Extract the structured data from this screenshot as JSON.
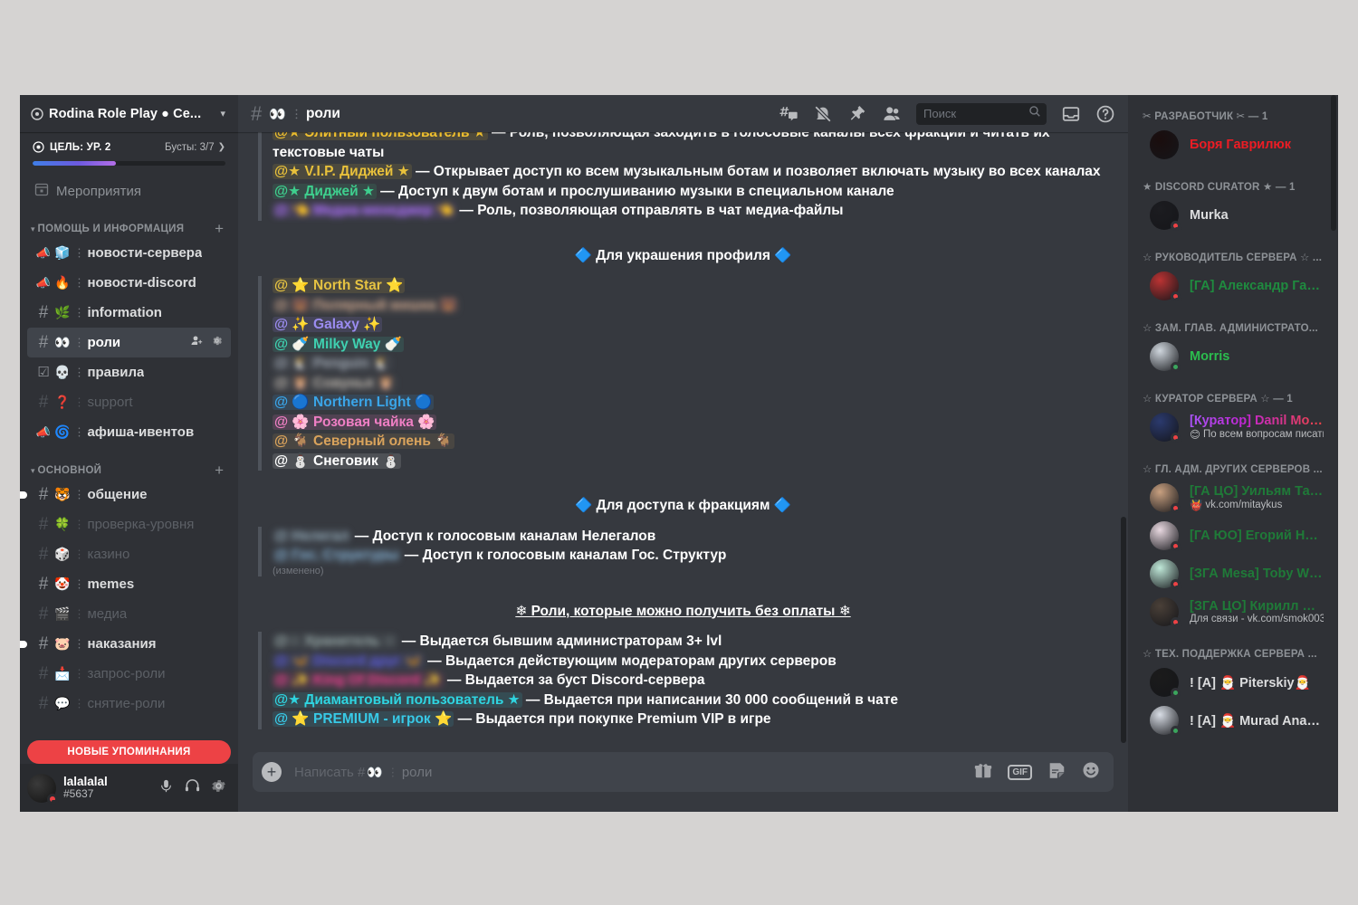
{
  "server": {
    "name": "Rodina Role Play ● Ce...",
    "icon": "server-badge-icon",
    "boost": {
      "goal_label": "ЦЕЛЬ: УР. 2",
      "boosts_label": "Бусты: 3/7",
      "progress_percent": 43
    }
  },
  "sidebar": {
    "events_label": "Мероприятия",
    "categories": [
      {
        "label": "ПОМОЩЬ И ИНФОРМАЦИЯ",
        "channels": [
          {
            "type": "announcement",
            "emoji": "🧊",
            "name": "новости-сервера",
            "state": "bright"
          },
          {
            "type": "announcement",
            "emoji": "🔥",
            "name": "новости-discord",
            "state": "bright"
          },
          {
            "type": "text",
            "emoji": "🌿",
            "name": "information",
            "state": "bright"
          },
          {
            "type": "text",
            "emoji": "👀",
            "name": "роли",
            "state": "active"
          },
          {
            "type": "rules",
            "emoji": "💀",
            "name": "правила",
            "state": "bright"
          },
          {
            "type": "text",
            "emoji": "❓",
            "name": "support",
            "state": "dim"
          },
          {
            "type": "announcement",
            "emoji": "🌀",
            "name": "афиша-ивентов",
            "state": "bright"
          }
        ]
      },
      {
        "label": "ОСНОВНОЙ",
        "channels": [
          {
            "type": "text",
            "emoji": "🐯",
            "name": "общение",
            "state": "bright",
            "unread": true
          },
          {
            "type": "text",
            "emoji": "🍀",
            "name": "проверка-уровня",
            "state": "dim"
          },
          {
            "type": "text",
            "emoji": "🎲",
            "name": "казино",
            "state": "dim"
          },
          {
            "type": "text",
            "emoji": "🤡",
            "name": "memes",
            "state": "bright"
          },
          {
            "type": "text",
            "emoji": "🎬",
            "name": "медиа",
            "state": "dim"
          },
          {
            "type": "text",
            "emoji": "🐷",
            "name": "наказания",
            "state": "bright",
            "unread": true
          },
          {
            "type": "text",
            "emoji": "📩",
            "name": "запрос-роли",
            "state": "dim"
          },
          {
            "type": "text",
            "emoji": "💬",
            "name": "снятие-роли",
            "state": "dim"
          }
        ]
      }
    ],
    "mentions_banner": "НОВЫЕ УПОМИНАНИЯ",
    "user": {
      "name": "lalalalal",
      "tag": "#5637",
      "status": "dnd",
      "icons": [
        "microphone-icon",
        "headphones-icon",
        "gear-icon"
      ]
    }
  },
  "topbar": {
    "channel_emoji": "👀",
    "channel_name": "роли",
    "icons": [
      "threads-icon",
      "notifications-muted-icon",
      "pinned-messages-icon",
      "member-list-icon",
      "inbox-icon",
      "help-icon"
    ],
    "search_placeholder": "Поиск",
    "search_value": ""
  },
  "chat": {
    "blocks": [
      {
        "type": "quote",
        "lines": [
          {
            "parts": [
              {
                "t": "mention",
                "text": "@★ Элитный пользователь ★",
                "color": "#f2c230",
                "bg": "rgba(242,194,48,.13)"
              },
              {
                "t": "text",
                "text": " — Роль, позволяющая заходить в голосовые каналы всех фракций и читать их текстовые чаты"
              }
            ]
          },
          {
            "parts": [
              {
                "t": "mention",
                "text": "@★ V.I.P. Диджей ★",
                "color": "#e8c13b",
                "bg": "rgba(232,193,59,.12)"
              },
              {
                "t": "text",
                "text": " — Открывает доступ ко всем музыкальным ботам и позволяет включать музыку во всех каналах"
              }
            ]
          },
          {
            "parts": [
              {
                "t": "mention",
                "text": "@★ Диджей ★",
                "color": "#3ecf8e",
                "bg": "rgba(62,207,142,.12)"
              },
              {
                "t": "text",
                "text": " — Доступ к двум ботам и прослушиванию музыки в специальном канале"
              }
            ]
          },
          {
            "parts": [
              {
                "t": "mention",
                "text": "@ 👈 Медиа-менеджер 👈",
                "color": "#a96ef5",
                "bg": "rgba(169,110,245,.16)",
                "blur": true
              },
              {
                "t": "text",
                "text": " — Роль, позволяющая отправлять в чат медиа-файлы"
              }
            ]
          }
        ]
      },
      {
        "type": "header",
        "text": "🔷 Для украшения профиля 🔷"
      },
      {
        "type": "quote",
        "lines": [
          {
            "parts": [
              {
                "t": "mention",
                "text": "@ ⭐ North Star ⭐",
                "color": "#e5c242",
                "bg": "rgba(229,194,66,.13)"
              }
            ]
          },
          {
            "parts": [
              {
                "t": "mention",
                "text": "@ 🐻 Полярный мишка 🐻",
                "color": "#c4a088",
                "bg": "rgba(196,160,136,.10)",
                "blur": true
              }
            ]
          },
          {
            "parts": [
              {
                "t": "mention",
                "text": "@ ✨ Galaxy ✨",
                "color": "#9b8cf0",
                "bg": "rgba(155,140,240,.14)"
              }
            ]
          },
          {
            "parts": [
              {
                "t": "mention",
                "text": "@ 🍼 Milky Way 🍼",
                "color": "#3fd0b0",
                "bg": "rgba(63,208,176,.13)"
              }
            ]
          },
          {
            "parts": [
              {
                "t": "mention",
                "text": "@ 🐧 Penguin 🐧",
                "color": "#9aa2ad",
                "bg": "rgba(154,162,173,.10)",
                "blur": true
              }
            ]
          },
          {
            "parts": [
              {
                "t": "mention",
                "text": "@ 🦉 Совунья 🦉",
                "color": "#b8b2aa",
                "bg": "rgba(184,178,170,.09)",
                "blur": true
              }
            ]
          },
          {
            "parts": [
              {
                "t": "mention",
                "text": "@ 🔵 Northern Light 🔵",
                "color": "#3aa5e8",
                "bg": "rgba(58,165,232,.14)"
              }
            ]
          },
          {
            "parts": [
              {
                "t": "mention",
                "text": "@ 🌸 Розовая чайка 🌸",
                "color": "#ef7fc4",
                "bg": "rgba(239,127,196,.14)"
              }
            ]
          },
          {
            "parts": [
              {
                "t": "mention",
                "text": "@ 🐐 Северный олень 🐐",
                "color": "#d9a35c",
                "bg": "rgba(217,163,92,.12)"
              }
            ]
          },
          {
            "parts": [
              {
                "t": "mention",
                "text": "@ ⛄ Снеговик ⛄",
                "color": "#ffffff",
                "bg": "rgba(255,255,255,.12)"
              }
            ]
          }
        ]
      },
      {
        "type": "header",
        "text": "🔷 Для доступа к фракциям 🔷"
      },
      {
        "type": "quote",
        "lines": [
          {
            "parts": [
              {
                "t": "mention",
                "text": "@ Нелегал",
                "color": "#8aa0ad",
                "bg": "rgba(138,160,173,.10)",
                "blur": true
              },
              {
                "t": "text",
                "text": " — Доступ к голосовым каналам Нелегалов"
              }
            ]
          },
          {
            "parts": [
              {
                "t": "mention",
                "text": "@ Гос. Структуры",
                "color": "#7fa8c9",
                "bg": "rgba(127,168,201,.10)",
                "blur": true
              },
              {
                "t": "text",
                "text": " — Доступ к голосовым каналам Гос. Структур"
              }
            ]
          }
        ],
        "edited": "(изменено)"
      },
      {
        "type": "header-underline",
        "text": "❄ Роли, которые можно получить без оплаты ❄"
      },
      {
        "type": "quote",
        "lines": [
          {
            "parts": [
              {
                "t": "mention",
                "text": "@☆ Хранитель ☆",
                "color": "#93a3a3",
                "bg": "rgba(147,163,163,.10)",
                "blur": true
              },
              {
                "t": "text",
                "text": " — Выдается бывшим администраторам 3+ lvl"
              }
            ]
          },
          {
            "parts": [
              {
                "t": "mention",
                "text": "@ 🦋 Discord друг 🦋",
                "color": "#5b5bd6",
                "bg": "rgba(91,91,214,.15)",
                "blur": true
              },
              {
                "t": "text",
                "text": " — Выдается действующим модераторам других серверов"
              }
            ]
          },
          {
            "parts": [
              {
                "t": "mention",
                "text": "@ ✨ King Of Discord ✨",
                "color": "#e8408f",
                "bg": "rgba(232,64,143,.15)",
                "blur": true
              },
              {
                "t": "text",
                "text": " — Выдается за буст Discord-сервера"
              }
            ]
          },
          {
            "parts": [
              {
                "t": "mention",
                "text": "@★ Диамантовый пользователь ★",
                "color": "#2fd4e0",
                "bg": "rgba(47,212,224,.13)"
              },
              {
                "t": "text",
                "text": " — Выдается при написании 30 000 сообщений в чате"
              }
            ]
          },
          {
            "parts": [
              {
                "t": "mention",
                "text": "@ ⭐ PREMIUM - игрок ⭐",
                "color": "#38c9e6",
                "bg": "rgba(56,201,230,.12)"
              },
              {
                "t": "text",
                "text": " — Выдается при покупке Premium VIP в игре"
              }
            ]
          }
        ]
      }
    ]
  },
  "composer": {
    "placeholder_prefix": "Написать #",
    "placeholder_emoji": "👀",
    "placeholder_channel": "роли",
    "icons": [
      "gift-icon",
      "gif-icon",
      "sticker-icon",
      "emoji-icon"
    ],
    "gif_label": "GIF"
  },
  "members": {
    "groups": [
      {
        "label": "✂ РАЗРАБОТЧИК ✂ — 1",
        "people": [
          {
            "name": "Боря Гаврилюк",
            "color": "#ed1c24",
            "status": "none",
            "avatar": "#1a0d0d",
            "sub": ""
          }
        ]
      },
      {
        "label": "★ DISCORD CURATOR ★ — 1",
        "people": [
          {
            "name": "Murka",
            "color": "#dcddde",
            "status": "dnd",
            "avatar": "#1c1c20",
            "sub": ""
          }
        ]
      },
      {
        "label": "☆ РУКОВОДИТЕЛЬ СЕРВЕРА ☆ ...",
        "people": [
          {
            "name": "[ГА] Александр Газа...",
            "color": "#1f8b3f",
            "status": "dnd",
            "avatar": "#b33",
            "sub": ""
          }
        ]
      },
      {
        "label": "☆ ЗАМ. ГЛАВ. АДМИНИСТРАТО...",
        "people": [
          {
            "name": "Morris",
            "color": "#2bbd4e",
            "status": "online",
            "avatar": "#cfd6dd",
            "sub": ""
          }
        ]
      },
      {
        "label": "☆ КУРАТОР СЕРВЕРА ☆ — 1",
        "people": [
          {
            "name": "[Куратор] Danil Morris",
            "color": "gradient",
            "status": "dnd",
            "avatar": "#2b3a6e",
            "sub": "По всем вопросам писать...",
            "sub_emoji": "😊"
          }
        ]
      },
      {
        "label": "☆ ГЛ. АДМ. ДРУГИХ СЕРВЕРОВ ...",
        "people": [
          {
            "name": "[ГА ЦО] Уильям Тай...",
            "color": "#1f7a38",
            "status": "dnd",
            "avatar": "#c8a080",
            "sub": "vk.com/mitaykus",
            "sub_emoji": "👹"
          },
          {
            "name": "[ГА ЮО] Егорий Нэт...",
            "color": "#1f7a38",
            "status": "dnd",
            "avatar": "#e8d8e0",
            "sub": ""
          },
          {
            "name": "[ЗГА Mesa] Toby Wil...",
            "color": "#1f7a38",
            "status": "dnd",
            "avatar": "#bfe8d8",
            "sub": ""
          },
          {
            "name": "[ЗГА ЦО] Кирилл Аг...",
            "color": "#1f7a38",
            "status": "dnd",
            "avatar": "#4a4038",
            "sub": "Для связи - vk.com/smok003"
          }
        ]
      },
      {
        "label": "☆ ТЕХ. ПОДДЕРЖКА СЕРВЕРА ...",
        "people": [
          {
            "name": "! [A] 🎅 Piterskiy🎅",
            "color": "#dcddde",
            "status": "online",
            "avatar": "#1b1b1b",
            "sub": ""
          },
          {
            "name": "! [A] 🎅 Murad Anak...",
            "color": "#dcddde",
            "status": "online",
            "avatar": "#d8dde5",
            "sub": ""
          }
        ]
      }
    ]
  },
  "colors": {
    "accent": "#5865f2",
    "danger": "#ed4245",
    "online": "#3ba55d",
    "sidebar_bg": "#2f3136",
    "chat_bg": "#36393f"
  }
}
